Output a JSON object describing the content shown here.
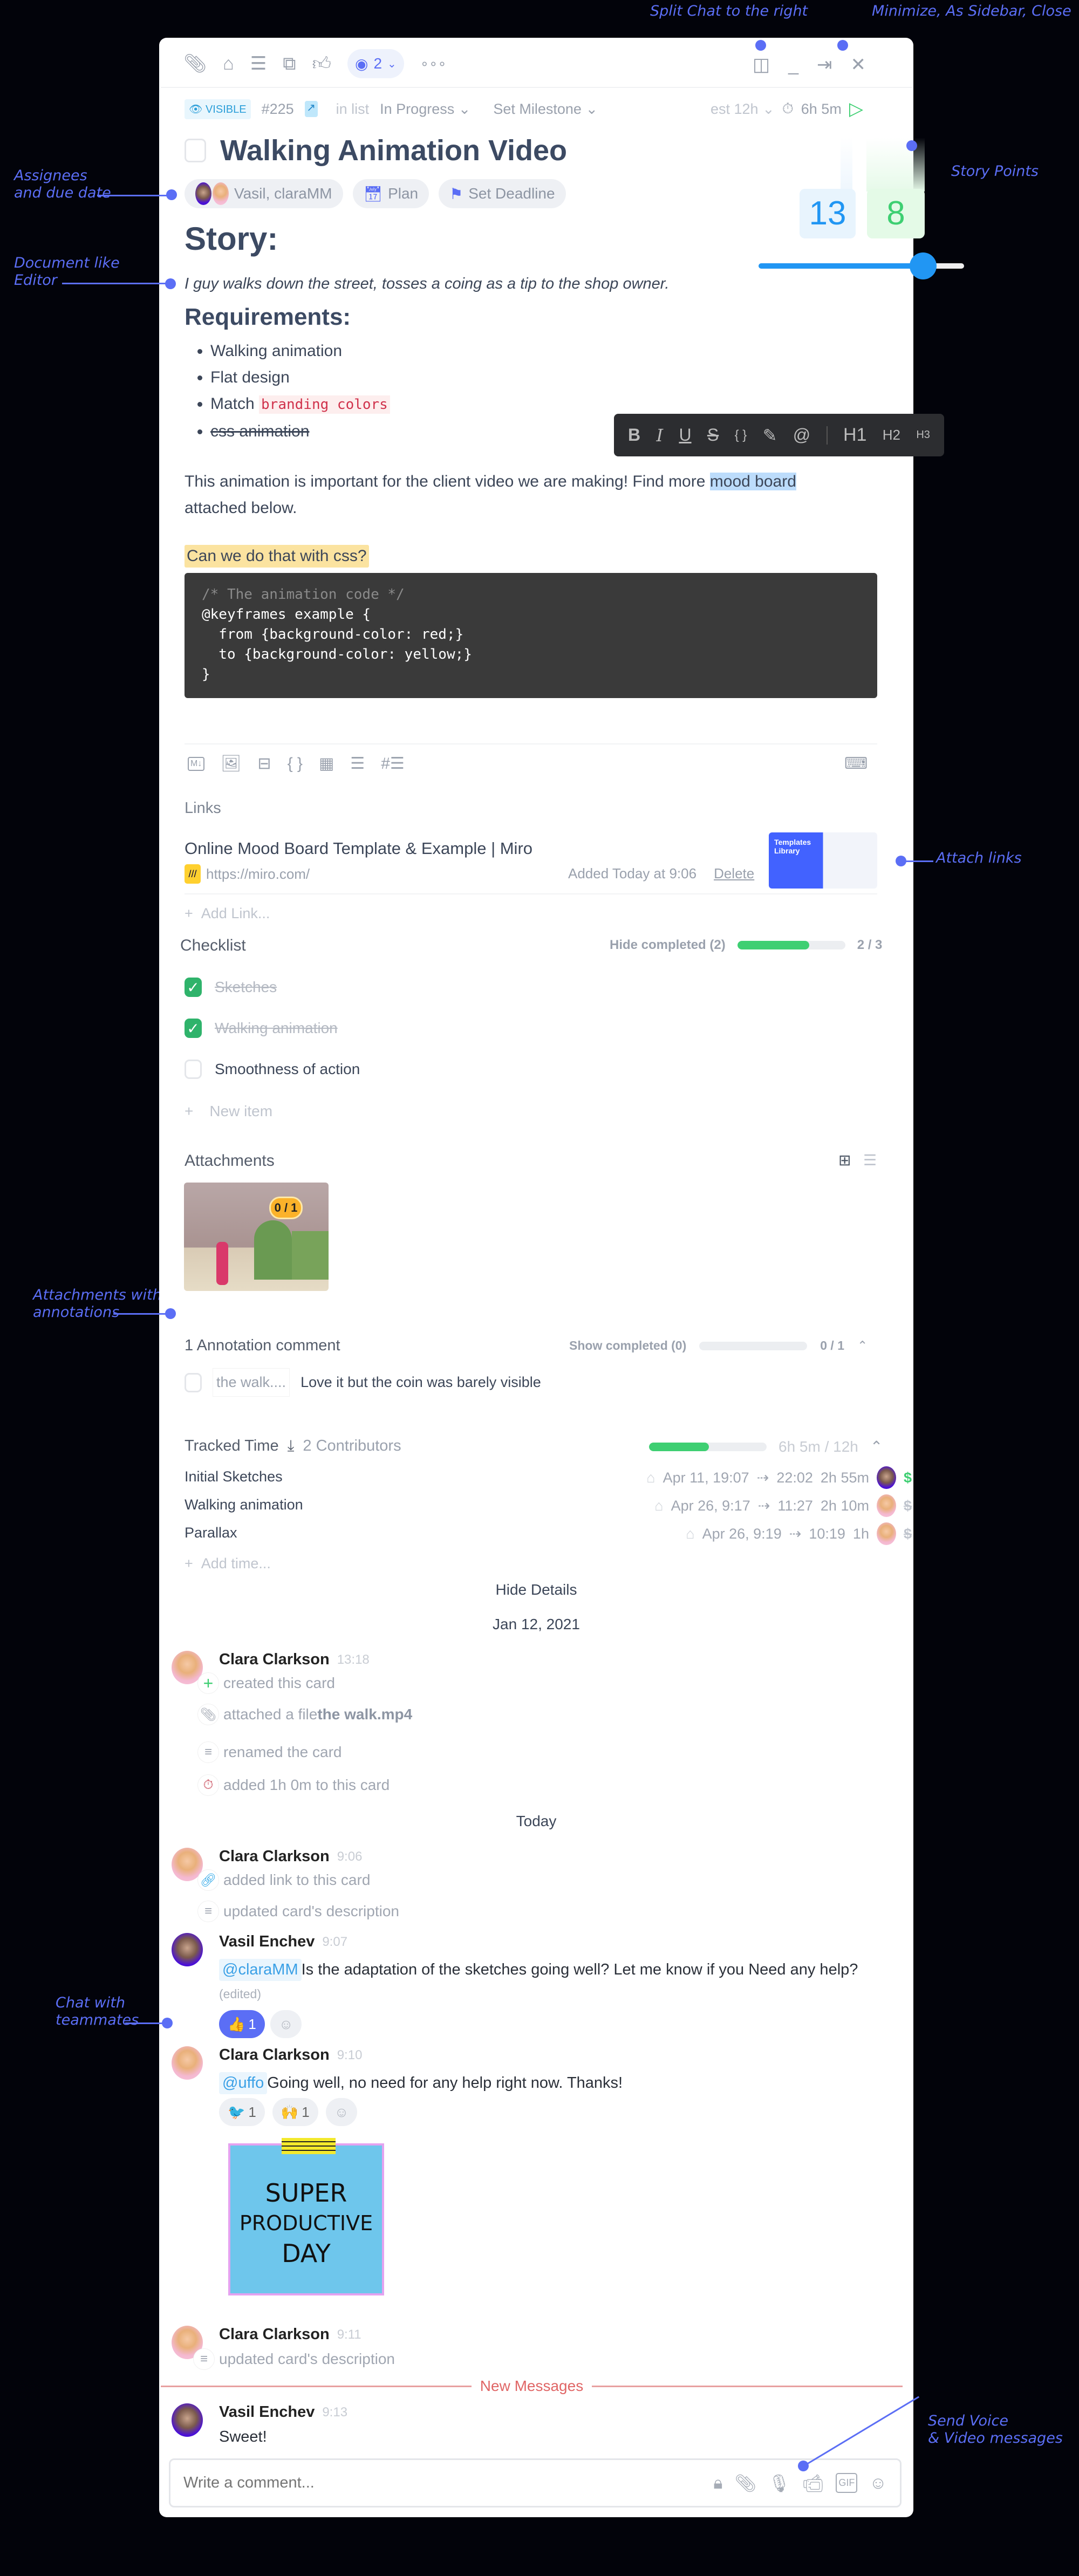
{
  "annotations": {
    "split_chat": "Split Chat to the right",
    "window_controls": "Minimize, As Sidebar, Close",
    "story_points": "Story Points",
    "assignees": [
      "Assignees",
      "and due date"
    ],
    "editor": [
      "Document like",
      "Editor"
    ],
    "attach_links": "Attach links",
    "attachments": [
      "Attachments with",
      "annotations"
    ],
    "chat": [
      "Chat with",
      "teammates"
    ],
    "voice": [
      "Send Voice",
      "& Video messages"
    ]
  },
  "toolbar": {
    "watchers_count": "2",
    "icons": [
      "paperclip-icon",
      "tag-icon",
      "checklist-icon",
      "dependencies-icon",
      "thumbs-up-icon",
      "eye-icon",
      "more-icon",
      "split-view-icon",
      "minimize-icon",
      "sidebar-icon",
      "close-icon"
    ]
  },
  "meta": {
    "visibility": "VISIBLE",
    "card_id": "#225",
    "in_list_label": "in list",
    "list": "In Progress",
    "milestone": "Set Milestone",
    "estimate": "est 12h",
    "tracked": "6h 5m"
  },
  "title": "Walking Animation Video",
  "assignees": {
    "names": "Vasil, claraMM",
    "plan": "Plan",
    "deadline": "Set Deadline"
  },
  "story_points": {
    "estimate": "13",
    "actual": "8",
    "slider_fraction": 0.8
  },
  "editor": {
    "heading": "Story:",
    "intro": "I guy walks down the street, tosses a coing as a tip to the shop owner.",
    "subheading": "Requirements:",
    "bullets": [
      {
        "text": "Walking animation"
      },
      {
        "text": "Flat design"
      },
      {
        "text": "Match ",
        "code": "branding colors"
      },
      {
        "text": "css animation",
        "strike": true
      }
    ],
    "paragraph_before": "This animation is important for the client video we are making! Find more ",
    "paragraph_selected": "mood board",
    "paragraph_line2": "attached below.",
    "highlight": "Can we do that with css?",
    "code": [
      "/* The animation code */",
      "@keyframes example {",
      "  from {background-color: red;}",
      "  to {background-color: yellow;}",
      "}"
    ],
    "format_toolbar": [
      "B",
      "I",
      "U",
      "S",
      "{ }",
      "✎",
      "@",
      "H1",
      "H2",
      "H3"
    ]
  },
  "links": {
    "title": "Links",
    "items": [
      {
        "title": "Online Mood Board Template & Example | Miro",
        "url": "https://miro.com/",
        "added": "Added Today at 9:06",
        "delete": "Delete",
        "thumb_text": "Templates Library"
      }
    ],
    "add": "Add Link..."
  },
  "checklist": {
    "title": "Checklist",
    "hide": "Hide completed (2)",
    "progress": "2 / 3",
    "fraction": 0.667,
    "items": [
      {
        "text": "Sketches",
        "done": true
      },
      {
        "text": "Walking animation",
        "done": true
      },
      {
        "text": "Smoothness of action",
        "done": false
      }
    ],
    "new_item": "New item"
  },
  "attachments": {
    "title": "Attachments",
    "badge": "0 / 1"
  },
  "annotation_comments": {
    "title": "1 Annotation comment",
    "show": "Show completed (0)",
    "progress": "0 / 1",
    "items": [
      {
        "snippet": "the walk....",
        "text": "Love it but the coin was barely visible"
      }
    ]
  },
  "tracked_time": {
    "title": "Tracked Time",
    "contributors": "2 Contributors",
    "summary": "6h 5m / 12h",
    "fraction": 0.507,
    "entries": [
      {
        "name": "Initial Sketches",
        "start": "Apr 11, 19:07",
        "end": "22:02",
        "duration": "2h 55m",
        "user": "vasil",
        "billable": true
      },
      {
        "name": "Walking animation",
        "start": "Apr 26, 9:17",
        "end": "11:27",
        "duration": "2h 10m",
        "user": "clara",
        "billable": false
      },
      {
        "name": "Parallax",
        "start": "Apr 26, 9:19",
        "end": "10:19",
        "duration": "1h",
        "user": "clara",
        "billable": false
      }
    ],
    "add": "Add time..."
  },
  "activity": {
    "hide_details": "Hide Details",
    "date1": "Jan 12, 2021",
    "today": "Today",
    "new_messages": "New Messages",
    "g1": {
      "name": "Clara Clarkson",
      "time": "13:18",
      "items": [
        "created this card",
        "attached a file ",
        "renamed the card",
        "added 1h 0m to this card"
      ],
      "file": "the walk.mp4"
    },
    "g2": {
      "name": "Clara Clarkson",
      "time": "9:06",
      "items": [
        "added link to this card",
        "updated card's description"
      ]
    },
    "m1": {
      "name": "Vasil Enchev",
      "time": "9:07",
      "mention": "@claraMM",
      "text": " Is the adaptation of the sketches going well? Let me know if you Need any help?",
      "edited": "(edited)",
      "reactions": [
        {
          "emoji": "👍",
          "count": "1"
        }
      ]
    },
    "m2": {
      "name": "Clara Clarkson",
      "time": "9:10",
      "mention": "@uffo",
      "text": " Going well, no need for any help right now. Thanks!",
      "reactions": [
        {
          "emoji": "🐦",
          "count": "1"
        },
        {
          "emoji": "🙌",
          "count": "1"
        }
      ],
      "sticker": [
        "SUPER",
        "PRODUCTIVE",
        "DAY"
      ]
    },
    "g3": {
      "name": "Clara Clarkson",
      "time": "9:11",
      "items": [
        "updated card's description"
      ]
    },
    "m3": {
      "name": "Vasil Enchev",
      "time": "9:13",
      "text": "Sweet!"
    }
  },
  "composer": {
    "placeholder": "Write a comment..."
  },
  "colors": {
    "accent": "#5b6ef5",
    "green": "#3ecf72",
    "blue": "#2196f3",
    "new_messages": "#e06666"
  }
}
